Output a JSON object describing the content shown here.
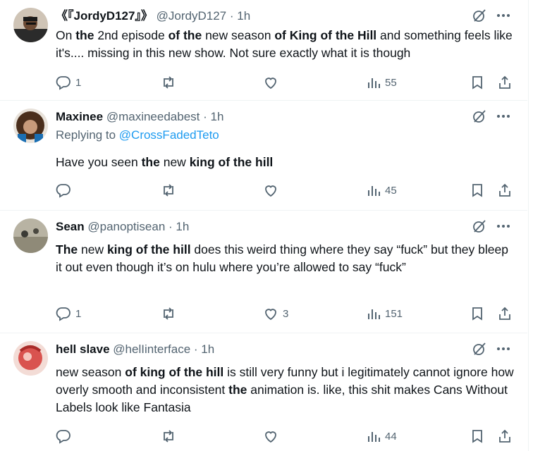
{
  "tweets": [
    {
      "name": "《『JordyD127』》",
      "handle": "@JordyD127 · 1h",
      "reply_prefix": "",
      "reply_link": "",
      "body_segments": [
        {
          "t": "On ",
          "b": false
        },
        {
          "t": "the",
          "b": true
        },
        {
          "t": " 2nd episode ",
          "b": false
        },
        {
          "t": "of the",
          "b": true
        },
        {
          "t": " new season ",
          "b": false
        },
        {
          "t": "of King of the Hill",
          "b": true
        },
        {
          "t": " and something feels like it's.... missing in this new show. Not sure exactly what it is though",
          "b": false
        }
      ],
      "replies": "1",
      "reposts": "",
      "likes": "",
      "views": "55"
    },
    {
      "name": "Maxinee",
      "handle": "@maxineedabest · 1h",
      "reply_prefix": "Replying to ",
      "reply_link": "@CrossFadedTeto",
      "body_segments": [
        {
          "t": "Have you seen ",
          "b": false
        },
        {
          "t": "the",
          "b": true
        },
        {
          "t": " new ",
          "b": false
        },
        {
          "t": "king of the hill",
          "b": true
        }
      ],
      "replies": "",
      "reposts": "",
      "likes": "",
      "views": "45"
    },
    {
      "name": "Sean",
      "handle": "@panoptisean · 1h",
      "reply_prefix": "",
      "reply_link": "",
      "body_segments": [
        {
          "t": "The",
          "b": true
        },
        {
          "t": " new ",
          "b": false
        },
        {
          "t": "king of the hill",
          "b": true
        },
        {
          "t": " does this weird thing where they say “fuck” but they bleep it out even though it’s on hulu where you’re allowed to say “fuck”",
          "b": false
        }
      ],
      "replies": "1",
      "reposts": "",
      "likes": "3",
      "views": "151"
    },
    {
      "name": "hell slave",
      "handle": "@helIinterface · 1h",
      "reply_prefix": "",
      "reply_link": "",
      "body_segments": [
        {
          "t": "new season ",
          "b": false
        },
        {
          "t": "of king of the hill",
          "b": true
        },
        {
          "t": " is still very funny but i legitimately cannot ignore how overly smooth and inconsistent ",
          "b": false
        },
        {
          "t": "the",
          "b": true
        },
        {
          "t": " animation is. like, this shit makes Cans Without Labels look like Fantasia",
          "b": false
        }
      ],
      "replies": "",
      "reposts": "",
      "likes": "",
      "views": "44"
    }
  ],
  "colors": {
    "text": "#0f1419",
    "secondary": "#536471",
    "link": "#1d9bf0",
    "border": "#eff3f4"
  },
  "icons": [
    "grok-icon",
    "more-icon",
    "reply-icon",
    "repost-icon",
    "like-icon",
    "views-icon",
    "bookmark-icon",
    "share-icon"
  ]
}
